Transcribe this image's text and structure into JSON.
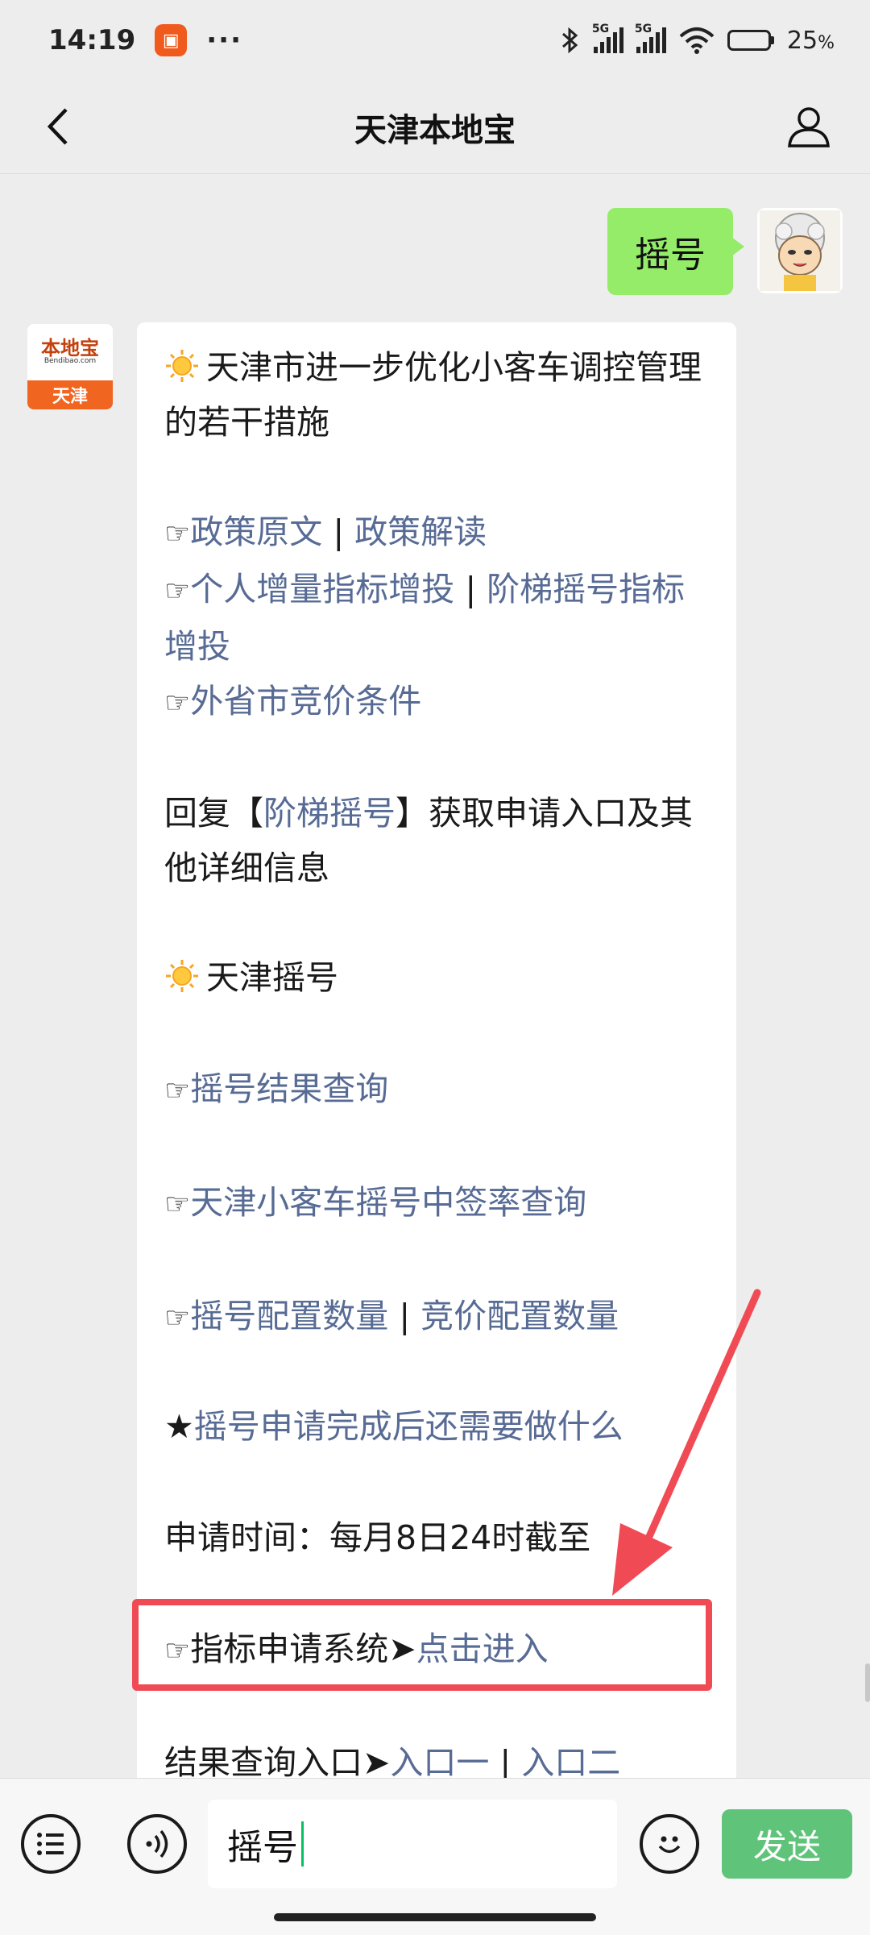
{
  "status_bar": {
    "time": "14:19",
    "signal1_label": "5G",
    "signal2_label": "5G",
    "battery_pct": "25",
    "battery_unit": "%",
    "battery_level": 0.25
  },
  "nav": {
    "title": "天津本地宝"
  },
  "user_message": {
    "text": "摇号"
  },
  "bot": {
    "avatar_brand": "本地宝",
    "avatar_url": "Bendibao.com",
    "avatar_city": "天津"
  },
  "message": {
    "heading1": "天津市进一步优化小客车调控管理的若干措施",
    "hand": "☞",
    "link_policy_original": "政策原文",
    "link_policy_interpret": "政策解读",
    "separator": " | ",
    "link_personal_increment": "个人增量指标增投",
    "link_tiered_lottery": "阶梯摇号指标增投",
    "link_out_of_province": "外省市竞价条件",
    "reply_prefix": "回复【",
    "reply_keyword": "阶梯摇号",
    "reply_suffix": "】获取申请入口及其他详细信息",
    "heading2": "天津摇号",
    "link_result_query": "摇号结果查询",
    "link_win_rate": "天津小客车摇号中签率查询",
    "link_lottery_quota": "摇号配置数量",
    "link_bid_quota": "竞价配置数量",
    "star": "★",
    "link_after_apply": "摇号申请完成后还需要做什么",
    "apply_time": "申请时间：每月8日24时截至",
    "system_label": "指标申请系统➤",
    "link_enter": "点击进入",
    "result_entry_label": "结果查询入口➤",
    "link_entry1": "入口一",
    "link_entry2": "入口二"
  },
  "input_bar": {
    "value": "摇号",
    "send_label": "发送"
  }
}
